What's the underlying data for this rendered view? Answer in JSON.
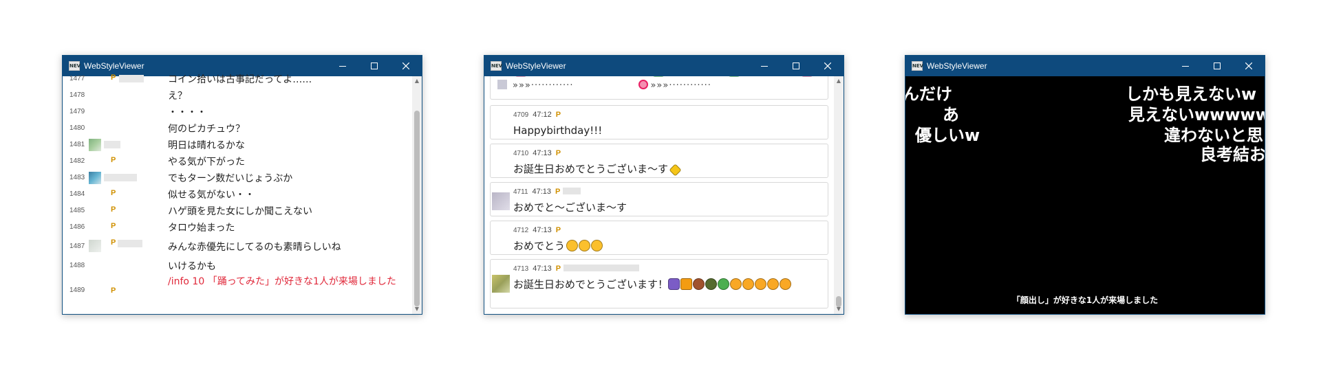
{
  "windows": [
    {
      "title": "WebStyleViewer"
    },
    {
      "title": "WebStyleViewer"
    },
    {
      "title": "WebStyleViewer"
    }
  ],
  "list1": {
    "rows": [
      {
        "num": "1477",
        "premium": "P",
        "text": "コイン拾いは古事記だってよ……"
      },
      {
        "num": "1478",
        "premium": "",
        "text": "え？"
      },
      {
        "num": "1479",
        "premium": "",
        "text": "・・・・"
      },
      {
        "num": "1480",
        "premium": "",
        "text": "何のピカチュウ？"
      },
      {
        "num": "1481",
        "premium": "",
        "text": "明日は晴れるかな"
      },
      {
        "num": "1482",
        "premium": "P",
        "text": "やる気が下がった"
      },
      {
        "num": "1483",
        "premium": "",
        "text": "でもターン数だいじょうぶか"
      },
      {
        "num": "1484",
        "premium": "P",
        "text": "似せる気がない・・"
      },
      {
        "num": "1485",
        "premium": "P",
        "text": "ハゲ頭を見た女にしか聞こえない"
      },
      {
        "num": "1486",
        "premium": "P",
        "text": "タロウ始まった"
      },
      {
        "num": "1487",
        "premium": "P",
        "text": "みんな赤優先にしてるのも素晴らしいね"
      },
      {
        "num": "1488",
        "premium": "",
        "text": "いけるかも"
      },
      {
        "num": "1489",
        "premium": "P",
        "text": "/info 10 「踊ってみた」が好きな1人が来場しました"
      }
    ]
  },
  "list2": {
    "top_line": "»»»············",
    "top_line2": "»»»············",
    "cards": [
      {
        "id": "4709",
        "time": "47:12",
        "premium": "P",
        "text": "Happybirthday!!!"
      },
      {
        "id": "4710",
        "time": "47:13",
        "premium": "P",
        "text": "お誕生日おめでとうございま～す"
      },
      {
        "id": "4711",
        "time": "47:13",
        "premium": "P",
        "text": "おめでと～ございま～す"
      },
      {
        "id": "4712",
        "time": "47:13",
        "premium": "P",
        "text": "おめでとう"
      },
      {
        "id": "4713",
        "time": "47:13",
        "premium": "P",
        "text": "お誕生日おめでとうございます！"
      }
    ]
  },
  "overlay": {
    "comments": [
      {
        "text": "んだけ"
      },
      {
        "text": "あ"
      },
      {
        "text": "優しいw"
      },
      {
        "text": "しかも見えないw"
      },
      {
        "text": "見えないwwwww"
      },
      {
        "text": "違わないと思"
      },
      {
        "text": "良考結お"
      }
    ],
    "notice": "「顔出し」が好きな1人が来場しました"
  },
  "colors": {
    "titlebar": "#0e4a7d",
    "premium": "#d09000",
    "info_text": "#e0283a",
    "overlay_bg": "#000000"
  }
}
